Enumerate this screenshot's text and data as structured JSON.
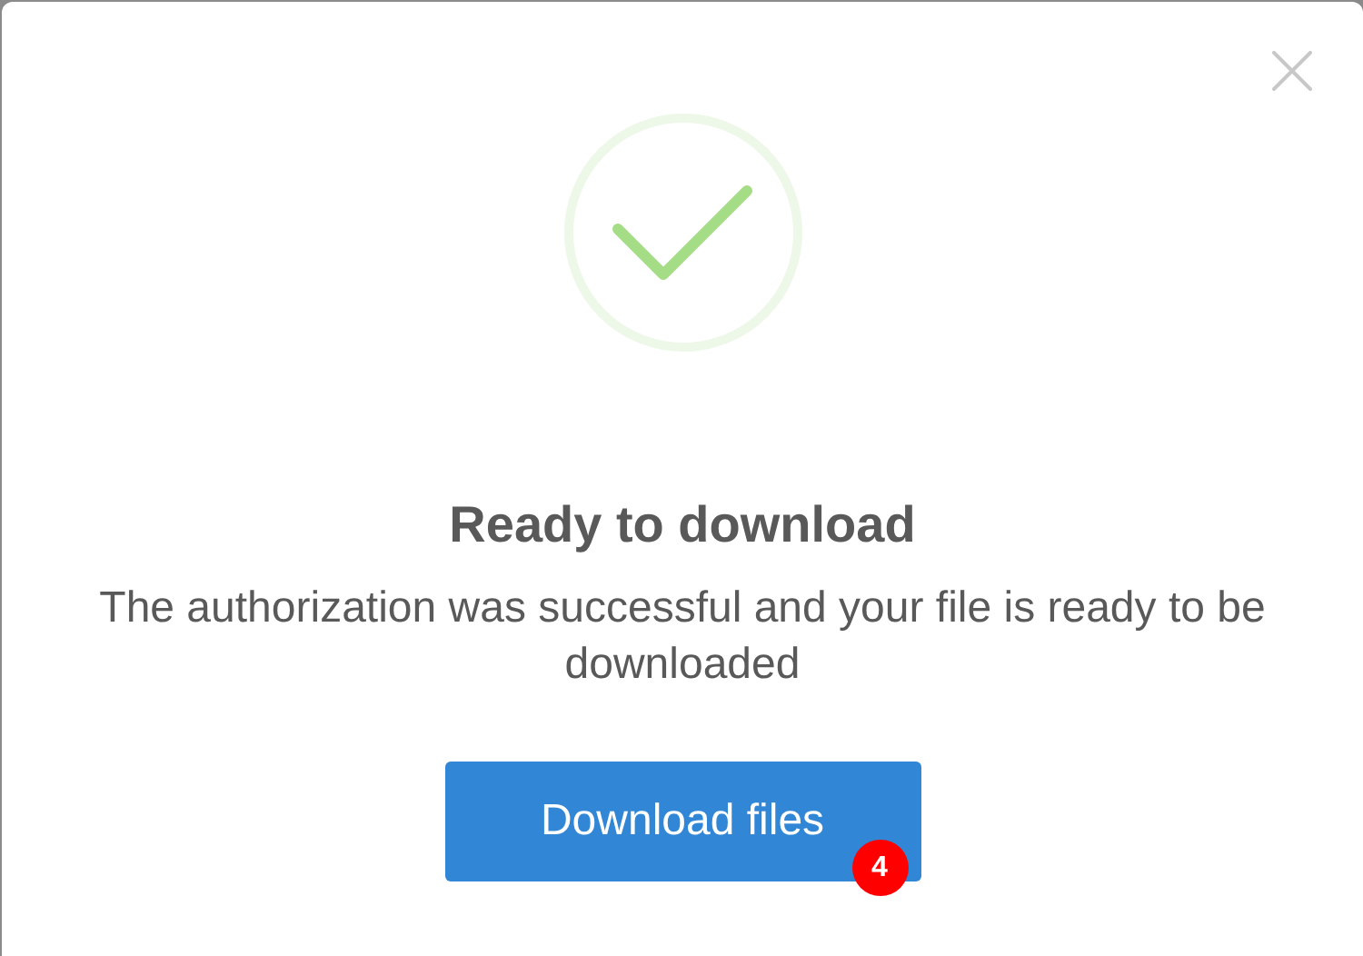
{
  "dialog": {
    "title": "Ready to download",
    "message": "The authorization was successful and your file is ready to be downloaded",
    "button": {
      "label": "Download files"
    },
    "badge": "4"
  }
}
